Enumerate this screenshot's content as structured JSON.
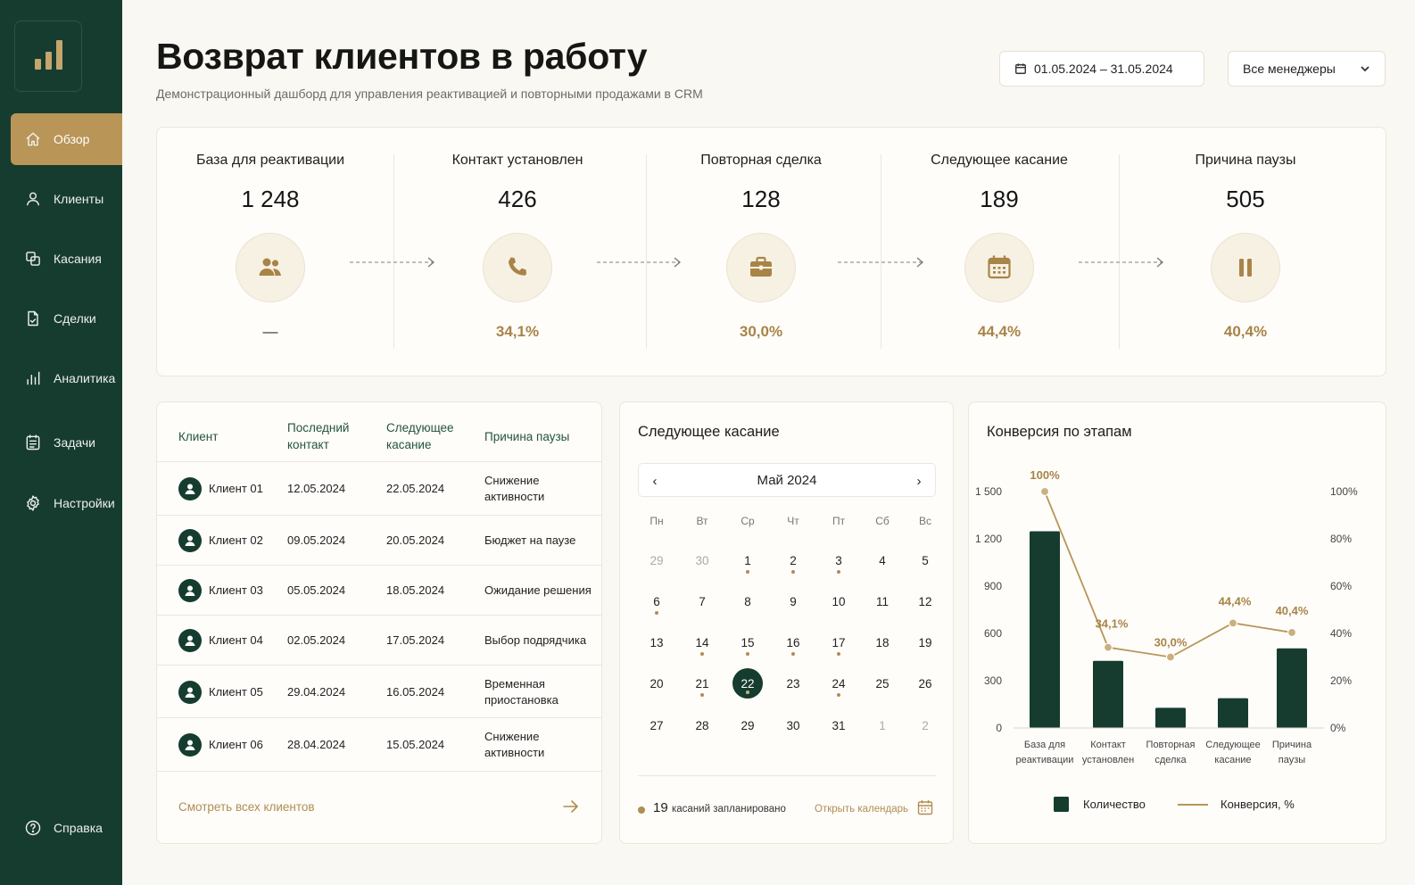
{
  "sidebar": {
    "logo_icon": "bar-chart-logo-icon",
    "items": [
      {
        "label": "Обзор",
        "icon": "home-icon",
        "active": true
      },
      {
        "label": "Клиенты",
        "icon": "user-icon"
      },
      {
        "label": "Касания",
        "icon": "copy-icon"
      },
      {
        "label": "Сделки",
        "icon": "document-icon"
      },
      {
        "label": "Аналитика",
        "icon": "bar-chart-icon"
      },
      {
        "label": "Задачи",
        "icon": "checklist-icon"
      },
      {
        "label": "Настройки",
        "icon": "gear-icon"
      }
    ],
    "help": {
      "label": "Справка",
      "icon": "help-icon"
    }
  },
  "header": {
    "title": "Возврат клиентов в работу",
    "subtitle": "Демонстрационный дашборд для управления реактивацией и повторными продажами в CRM",
    "date_range": "01.05.2024 – 31.05.2024",
    "manager_filter": "Все менеджеры"
  },
  "funnel": [
    {
      "title": "База для реактивации",
      "value": "1 248",
      "percent": "—",
      "icon": "users-icon"
    },
    {
      "title": "Контакт установлен",
      "value": "426",
      "percent": "34,1%",
      "icon": "phone-icon"
    },
    {
      "title": "Повторная сделка",
      "value": "128",
      "percent": "30,0%",
      "icon": "briefcase-icon"
    },
    {
      "title": "Следующее касание",
      "value": "189",
      "percent": "44,4%",
      "icon": "calendar-icon"
    },
    {
      "title": "Причина паузы",
      "value": "505",
      "percent": "40,4%",
      "icon": "pause-icon"
    }
  ],
  "clients_table": {
    "headers": [
      "Клиент",
      "Последний контакт",
      "Следующее касание",
      "Причина паузы"
    ],
    "rows": [
      {
        "client": "Клиент 01",
        "last": "12.05.2024",
        "next": "22.05.2024",
        "reason": "Снижение активности"
      },
      {
        "client": "Клиент 02",
        "last": "09.05.2024",
        "next": "20.05.2024",
        "reason": "Бюджет на паузе"
      },
      {
        "client": "Клиент 03",
        "last": "05.05.2024",
        "next": "18.05.2024",
        "reason": "Ожидание решения"
      },
      {
        "client": "Клиент 04",
        "last": "02.05.2024",
        "next": "17.05.2024",
        "reason": "Выбор подрядчика"
      },
      {
        "client": "Клиент 05",
        "last": "29.04.2024",
        "next": "16.05.2024",
        "reason": "Временная приостановка"
      },
      {
        "client": "Клиент 06",
        "last": "28.04.2024",
        "next": "15.05.2024",
        "reason": "Снижение активности"
      }
    ],
    "see_all": "Смотреть всех клиентов"
  },
  "calendar": {
    "title": "Следующее касание",
    "month": "Май 2024",
    "prev": "‹",
    "next": "›",
    "weekdays": [
      "Пн",
      "Вт",
      "Ср",
      "Чт",
      "Пт",
      "Сб",
      "Вс"
    ],
    "weeks": [
      [
        {
          "d": "29",
          "muted": true
        },
        {
          "d": "30",
          "muted": true
        },
        {
          "d": "1",
          "dot": true
        },
        {
          "d": "2",
          "dot": true
        },
        {
          "d": "3",
          "dot": true
        },
        {
          "d": "4"
        },
        {
          "d": "5"
        }
      ],
      [
        {
          "d": "6",
          "dot": true
        },
        {
          "d": "7"
        },
        {
          "d": "8"
        },
        {
          "d": "9"
        },
        {
          "d": "10"
        },
        {
          "d": "11"
        },
        {
          "d": "12"
        }
      ],
      [
        {
          "d": "13"
        },
        {
          "d": "14",
          "dot": true
        },
        {
          "d": "15",
          "dot": true
        },
        {
          "d": "16",
          "dot": true
        },
        {
          "d": "17",
          "dot": true
        },
        {
          "d": "18"
        },
        {
          "d": "19"
        }
      ],
      [
        {
          "d": "20"
        },
        {
          "d": "21",
          "dot": true
        },
        {
          "d": "22",
          "dot": true,
          "today": true
        },
        {
          "d": "23"
        },
        {
          "d": "24",
          "dot": true
        },
        {
          "d": "25"
        },
        {
          "d": "26"
        }
      ],
      [
        {
          "d": "27"
        },
        {
          "d": "28"
        },
        {
          "d": "29"
        },
        {
          "d": "30"
        },
        {
          "d": "31"
        },
        {
          "d": "1",
          "muted": true
        },
        {
          "d": "2",
          "muted": true
        }
      ]
    ],
    "scheduled_count": "19",
    "scheduled_label": "касаний запланировано",
    "open_calendar": "Открыть календарь"
  },
  "chart_data": {
    "type": "bar",
    "title": "Конверсия по этапам",
    "categories": [
      "База для реактивации",
      "Контакт установлен",
      "Повторная сделка",
      "Следующее касание",
      "Причина паузы"
    ],
    "category_lines": [
      [
        "База для",
        "реактивации"
      ],
      [
        "Контакт",
        "установлен"
      ],
      [
        "Повторная",
        "сделка"
      ],
      [
        "Следующее",
        "касание"
      ],
      [
        "Причина",
        "паузы"
      ]
    ],
    "series": [
      {
        "name": "Количество",
        "type": "bar",
        "axis": "left",
        "values": [
          1248,
          426,
          128,
          189,
          505
        ],
        "color": "#163c30"
      },
      {
        "name": "Конверсия, %",
        "type": "line",
        "axis": "right",
        "values": [
          100,
          34.1,
          30.0,
          44.4,
          40.4
        ],
        "labels": [
          "100%",
          "34,1%",
          "30,0%",
          "44,4%",
          "40,4%"
        ],
        "color": "#b99558"
      }
    ],
    "y_left": {
      "ticks": [
        0,
        300,
        600,
        900,
        1200,
        1500
      ],
      "tick_labels": [
        "0",
        "300",
        "600",
        "900",
        "1 200",
        "1 500"
      ],
      "range": [
        0,
        1500
      ]
    },
    "y_right": {
      "ticks": [
        0,
        20,
        40,
        60,
        80,
        100
      ],
      "tick_labels": [
        "0%",
        "20%",
        "40%",
        "60%",
        "80%",
        "100%"
      ],
      "range": [
        0,
        100
      ]
    },
    "legend_position": "bottom",
    "grid": false
  }
}
